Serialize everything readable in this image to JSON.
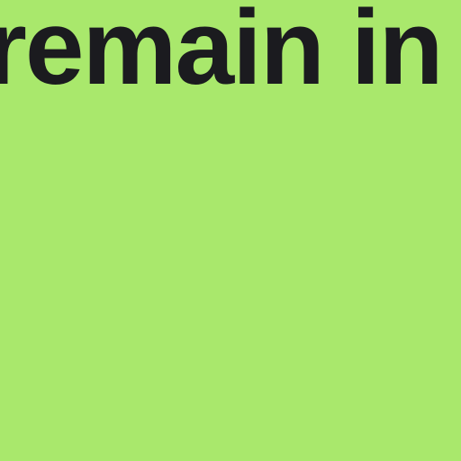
{
  "page": {
    "background_color": "#a9e86c",
    "text_color": "#1b1b1f",
    "headline": "remain in"
  }
}
